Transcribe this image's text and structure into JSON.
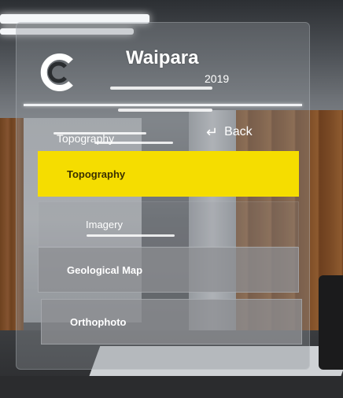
{
  "panel": {
    "title": "Waipara",
    "year": "2019",
    "section_label": "Topography",
    "back_label": "Back",
    "menu": [
      {
        "label": "Topography",
        "selected": true
      },
      {
        "label": "Imagery",
        "selected": false
      },
      {
        "label": "Geological Map",
        "selected": false
      },
      {
        "label": "Orthophoto",
        "selected": false
      }
    ]
  },
  "colors": {
    "selected": "#f5dd00",
    "text": "#ffffff"
  },
  "icons": {
    "logo": "c-logo-icon",
    "back": "back-arrow-icon"
  }
}
